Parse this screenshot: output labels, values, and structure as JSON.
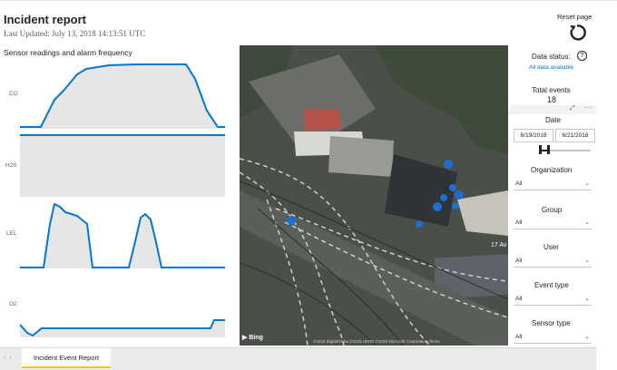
{
  "report": {
    "title": "Incident report",
    "last_updated": "Last Updated: July 13, 2018 14:13:51 UTC",
    "reset_label": "Reset page"
  },
  "chart": {
    "title": "Sensor readings and alarm frequency",
    "panels": [
      "CO",
      "H2S",
      "LEL",
      "O2"
    ],
    "line_color": "#0078d4",
    "fill_color": "#e6e6e6"
  },
  "map": {
    "logo": "Bing",
    "attribution": "©2018 DigitalGlobe ©2018 HERE ©2018 Microsoft Corporation Terms",
    "street_label": "17 Av",
    "marker_color": "#1f6fd1"
  },
  "slicers": {
    "data_status_label": "Data status:",
    "help_icon": "question-circle-icon",
    "data_status_value": "All data available",
    "total_events_label": "Total events",
    "total_events_value": "18",
    "date_label": "Date",
    "date_start": "6/19/2018",
    "date_end": "6/21/2018",
    "dropdowns": [
      {
        "label": "Organization",
        "value": "All"
      },
      {
        "label": "Group",
        "value": "All"
      },
      {
        "label": "User",
        "value": "All"
      },
      {
        "label": "Event type",
        "value": "All"
      },
      {
        "label": "Sensor type",
        "value": "All"
      }
    ]
  },
  "tabs": {
    "active": "Incident Event Report"
  }
}
